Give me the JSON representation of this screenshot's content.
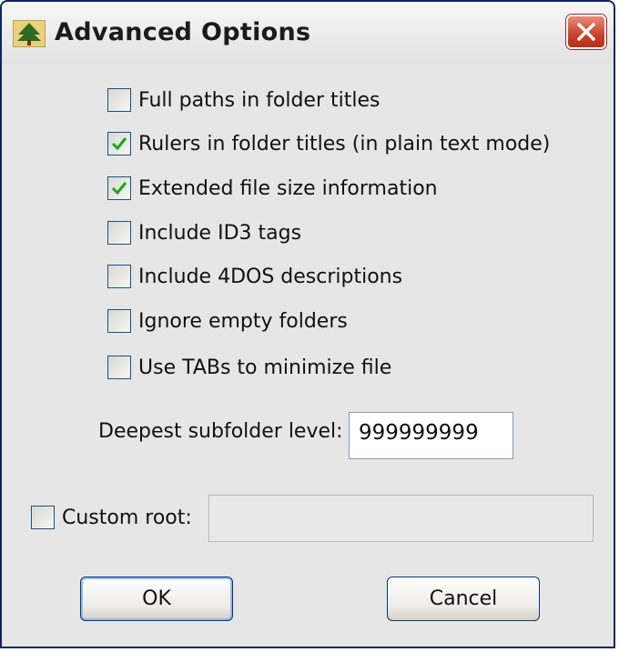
{
  "window": {
    "title": "Advanced Options",
    "app_icon": "tree-icon",
    "close_icon": "close-icon"
  },
  "options": [
    {
      "label": "Full paths in folder titles",
      "checked": false
    },
    {
      "label": "Rulers in folder titles (in plain text mode)",
      "checked": true
    },
    {
      "label": "Extended file size information",
      "checked": true
    },
    {
      "label": "Include ID3 tags",
      "checked": false
    },
    {
      "label": "Include 4DOS descriptions",
      "checked": false
    },
    {
      "label": "Ignore empty folders",
      "checked": false
    },
    {
      "label": "Use TABs to minimize file",
      "checked": false
    }
  ],
  "depth": {
    "label": "Deepest subfolder level:",
    "value": "999999999"
  },
  "custom_root": {
    "label": "Custom root:",
    "checked": false,
    "value": ""
  },
  "buttons": {
    "ok": "OK",
    "cancel": "Cancel"
  },
  "colors": {
    "check_mark": "#21a121",
    "close_button": "#c9412a"
  }
}
